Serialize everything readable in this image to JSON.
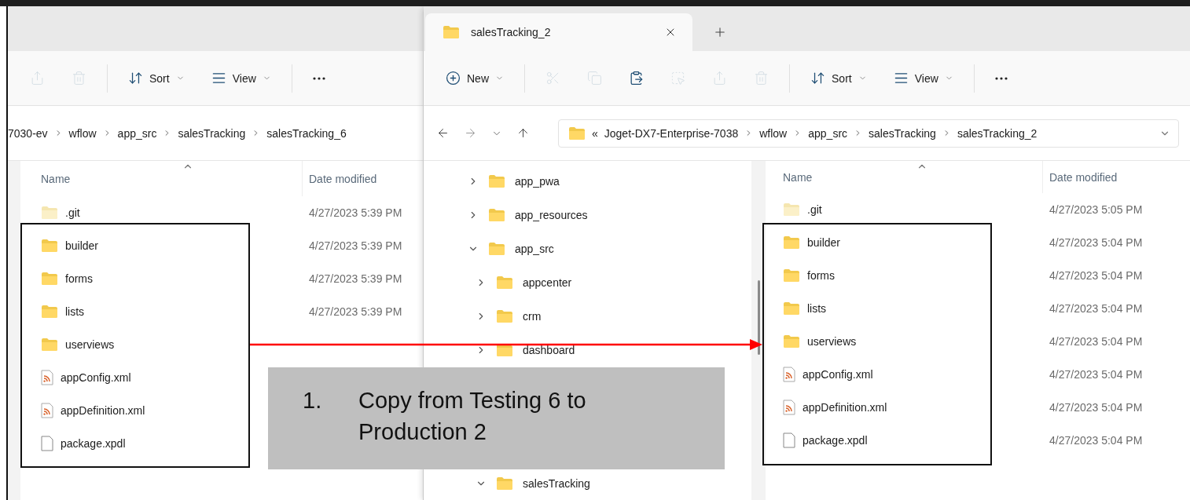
{
  "back_window": {
    "toolbar": [
      {
        "kind": "share",
        "disabled": true
      },
      {
        "kind": "delete",
        "disabled": true
      },
      {
        "kind": "sort",
        "label": "Sort",
        "disabled": false
      },
      {
        "kind": "view",
        "label": "View",
        "disabled": false
      },
      {
        "kind": "more",
        "disabled": false
      }
    ],
    "breadcrumb": [
      "7030-ev",
      "wflow",
      "app_src",
      "salesTracking",
      "salesTracking_6"
    ],
    "columns": [
      "Name",
      "Date modified"
    ],
    "files": [
      {
        "name": ".git",
        "kind": "hidden_folder",
        "date": "4/27/2023 5:39 PM"
      },
      {
        "name": "builder",
        "kind": "folder",
        "date": "4/27/2023 5:39 PM"
      },
      {
        "name": "forms",
        "kind": "folder",
        "date": "4/27/2023 5:39 PM"
      },
      {
        "name": "lists",
        "kind": "folder",
        "date": "4/27/2023 5:39 PM"
      },
      {
        "name": "userviews",
        "kind": "folder"
      },
      {
        "name": "appConfig.xml",
        "kind": "xml"
      },
      {
        "name": "appDefinition.xml",
        "kind": "xml"
      },
      {
        "name": "package.xpdl",
        "kind": "file"
      }
    ]
  },
  "front_window": {
    "tab": {
      "title": "salesTracking_2",
      "selected": true
    },
    "toolbar": [
      {
        "kind": "new",
        "label": "New",
        "disabled": false
      },
      {
        "kind": "cut",
        "disabled": true
      },
      {
        "kind": "copy",
        "disabled": true
      },
      {
        "kind": "paste",
        "disabled": false
      },
      {
        "kind": "rename",
        "disabled": true
      },
      {
        "kind": "share",
        "disabled": true
      },
      {
        "kind": "delete",
        "disabled": true
      },
      {
        "kind": "sort",
        "label": "Sort",
        "disabled": false
      },
      {
        "kind": "view",
        "label": "View",
        "disabled": false
      },
      {
        "kind": "more",
        "disabled": false
      }
    ],
    "overflow_mark": "«",
    "breadcrumb": [
      "Joget-DX7-Enterprise-7038",
      "wflow",
      "app_src",
      "salesTracking",
      "salesTracking_2"
    ],
    "nav_tree": [
      {
        "label": "app_pwa",
        "expanded": false
      },
      {
        "label": "app_resources",
        "expanded": false
      },
      {
        "label": "app_src",
        "expanded": true,
        "children": [
          {
            "label": "appcenter",
            "expanded": false
          },
          {
            "label": "crm",
            "expanded": false
          },
          {
            "label": "dashboard",
            "expanded": false
          },
          {
            "label": "salesTracking",
            "expanded": true
          }
        ]
      }
    ],
    "columns": [
      "Name",
      "Date modified"
    ],
    "files": [
      {
        "name": ".git",
        "kind": "hidden_folder",
        "date": "4/27/2023 5:05 PM"
      },
      {
        "name": "builder",
        "kind": "folder",
        "date": "4/27/2023 5:04 PM"
      },
      {
        "name": "forms",
        "kind": "folder",
        "date": "4/27/2023 5:04 PM"
      },
      {
        "name": "lists",
        "kind": "folder",
        "date": "4/27/2023 5:04 PM"
      },
      {
        "name": "userviews",
        "kind": "folder",
        "date": "4/27/2023 5:04 PM"
      },
      {
        "name": "appConfig.xml",
        "kind": "xml",
        "date": "4/27/2023 5:04 PM"
      },
      {
        "name": "appDefinition.xml",
        "kind": "xml",
        "date": "4/27/2023 5:04 PM"
      },
      {
        "name": "package.xpdl",
        "kind": "file",
        "date": "4/27/2023 5:04 PM"
      }
    ]
  },
  "callout": {
    "number": "1.",
    "text": "Copy from Testing 6 to Production 2"
  }
}
